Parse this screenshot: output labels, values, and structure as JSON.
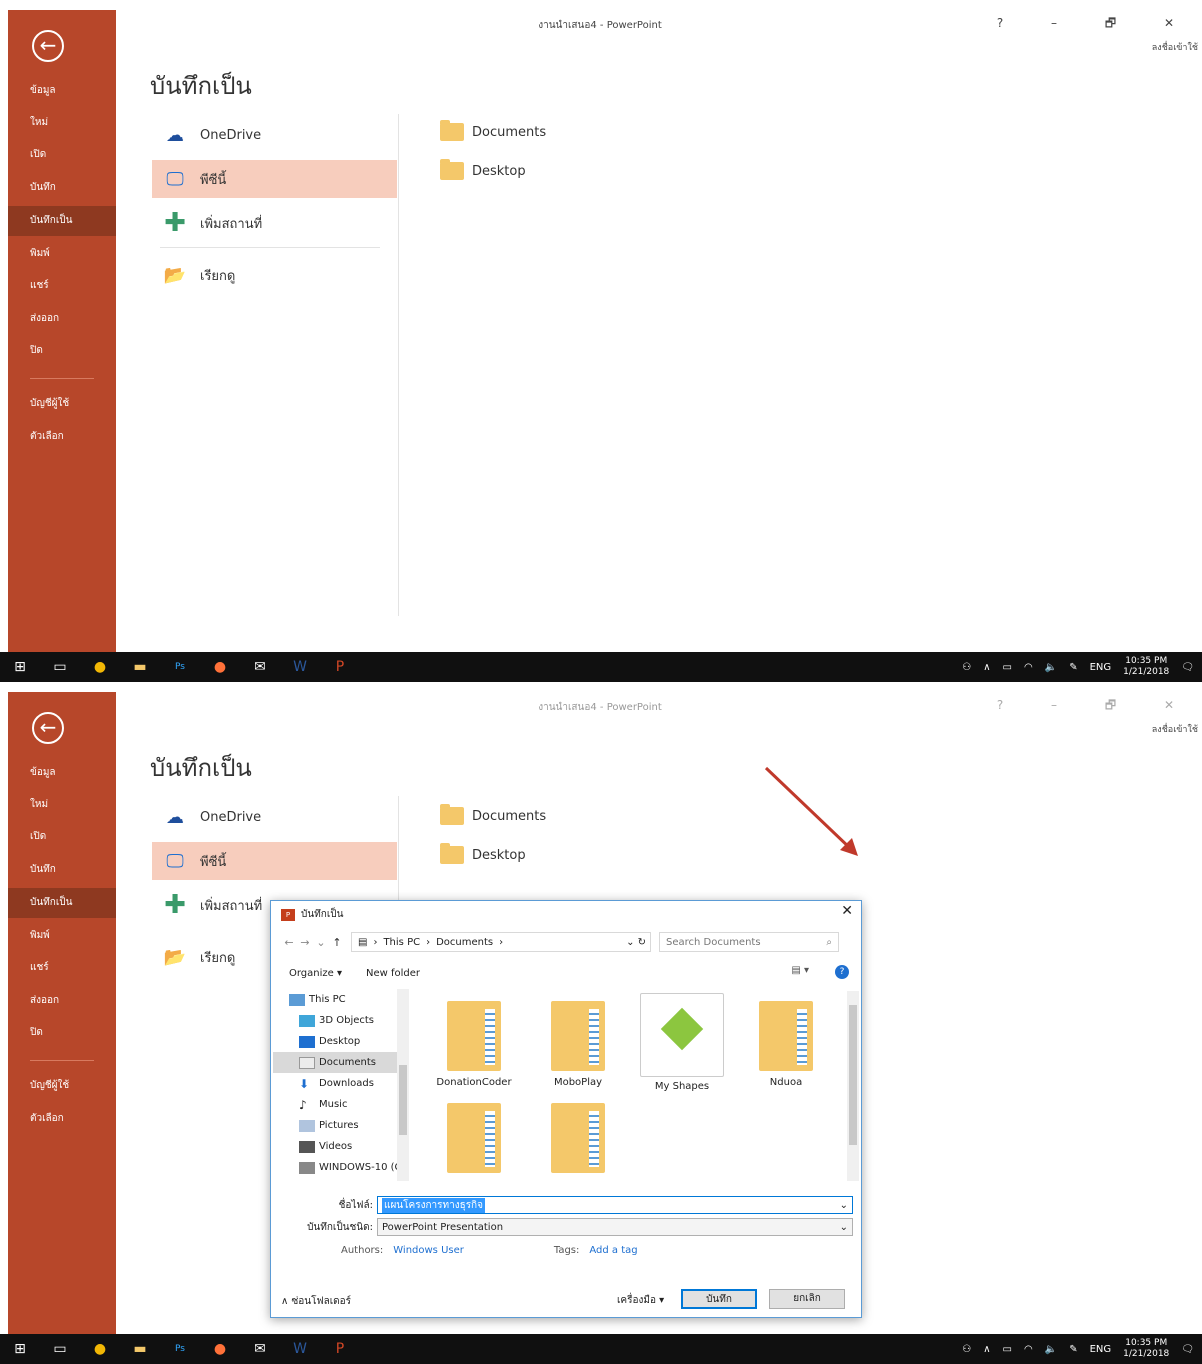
{
  "window": {
    "title": "งานนำเสนอ4 - PowerPoint",
    "controls": "? – 🗗 ✕",
    "signin": "ลงชื่อเข้าใช้"
  },
  "sidebar": {
    "back_icon": "back-arrow-icon",
    "items": [
      {
        "label": "ข้อมูล"
      },
      {
        "label": "ใหม่"
      },
      {
        "label": "เปิด"
      },
      {
        "label": "บันทึก"
      },
      {
        "label": "บันทึกเป็น"
      },
      {
        "label": "พิมพ์"
      },
      {
        "label": "แชร์"
      },
      {
        "label": "ส่งออก"
      },
      {
        "label": "ปิด"
      },
      {
        "label": "บัญชีผู้ใช้"
      },
      {
        "label": "ตัวเลือก"
      }
    ],
    "active_item": "บันทึกเป็น",
    "accent_color": "#b7472a"
  },
  "main": {
    "title": "บันทึกเป็น",
    "locations": [
      {
        "label": "OneDrive",
        "icon": "cloud-icon"
      },
      {
        "label": "พีซีนี้",
        "icon": "pc-icon"
      },
      {
        "label": "เพิ่มสถานที่",
        "icon": "plus-icon"
      },
      {
        "label": "เรียกดู",
        "icon": "open-folder-icon"
      }
    ],
    "folders": [
      {
        "label": "Documents"
      },
      {
        "label": "Desktop"
      }
    ]
  },
  "taskbar": {
    "apps": [
      "windows-start-icon",
      "task-view-icon",
      "chrome-icon",
      "file-explorer-icon",
      "photoshop-icon",
      "firefox-icon",
      "mail-icon",
      "word-icon",
      "powerpoint-icon"
    ],
    "lang": "ENG",
    "time": "10:35 PM",
    "date": "1/21/2018"
  },
  "dialog": {
    "title": "บันทึกเป็น",
    "breadcrumb": [
      "This PC",
      "Documents"
    ],
    "search_placeholder": "Search Documents",
    "organize": "Organize ▾",
    "new_folder": "New folder",
    "nav_items": [
      {
        "label": "This PC"
      },
      {
        "label": "3D Objects"
      },
      {
        "label": "Desktop"
      },
      {
        "label": "Documents"
      },
      {
        "label": "Downloads"
      },
      {
        "label": "Music"
      },
      {
        "label": "Pictures"
      },
      {
        "label": "Videos"
      },
      {
        "label": "WINDOWS-10 (C"
      }
    ],
    "files": [
      {
        "label": "DonationCoder"
      },
      {
        "label": "MoboPlay"
      },
      {
        "label": "My Shapes"
      },
      {
        "label": "Nduoa"
      },
      {
        "label": ""
      },
      {
        "label": ""
      }
    ],
    "filename_label": "ชื่อไฟล์:",
    "filename_value": "แผนโครงการทางธุรกิจ",
    "filetype_label": "บันทึกเป็นชนิด:",
    "filetype_value": "PowerPoint Presentation",
    "authors_label": "Authors:",
    "authors_value": "Windows User",
    "tags_label": "Tags:",
    "tags_value": "Add a tag",
    "hide_folders": "∧ ซ่อนโฟลเดอร์",
    "tools": "เครื่องมือ ▾",
    "save": "บันทึก",
    "cancel": "ยกเลิก"
  }
}
